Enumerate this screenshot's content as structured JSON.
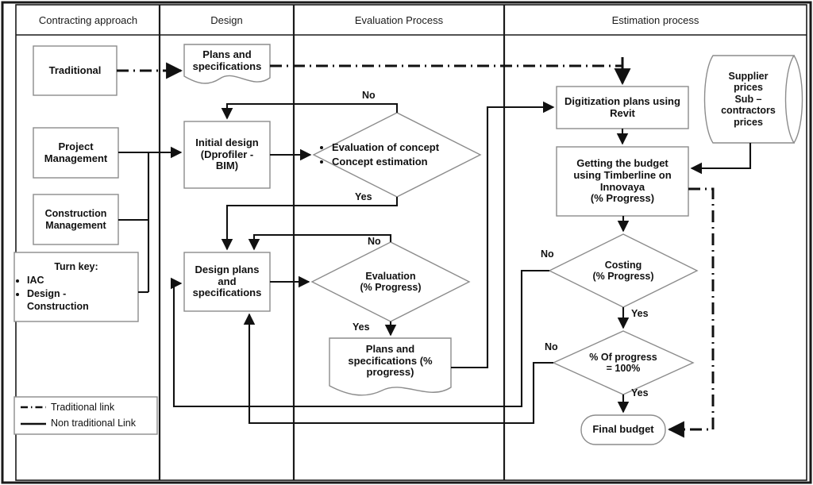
{
  "columns": [
    {
      "id": "contracting",
      "label": "Contracting approach"
    },
    {
      "id": "design",
      "label": "Design"
    },
    {
      "id": "evaluation",
      "label": "Evaluation Process"
    },
    {
      "id": "estimation",
      "label": "Estimation process"
    }
  ],
  "nodes": {
    "traditional": {
      "label": "Traditional",
      "shape": "rect"
    },
    "project_management": {
      "label": "Project\nManagement",
      "shape": "rect"
    },
    "construction_management": {
      "label": "Construction\nManagement",
      "shape": "rect"
    },
    "turnkey": {
      "shape": "rect",
      "heading": "Turn key:",
      "items": [
        "IAC",
        "Design -\nConstruction"
      ]
    },
    "plans_and_specifications": {
      "label": "Plans and\nspecifications",
      "shape": "document"
    },
    "initial_design": {
      "label": "Initial design\n(Dprofiler -\nBIM)",
      "shape": "rect"
    },
    "design_plans_and_specifications": {
      "label": "Design plans\nand\nspecifications",
      "shape": "rect"
    },
    "evaluation_concept": {
      "shape": "diamond",
      "items": [
        "Evaluation of concept",
        "Concept estimation"
      ]
    },
    "evaluation_progress": {
      "label": "Evaluation\n(% Progress)",
      "shape": "diamond"
    },
    "plans_specs_progress": {
      "label": "Plans and\nspecifications (%\nprogress)",
      "shape": "document"
    },
    "digitization": {
      "label": "Digitization plans using\nRevit",
      "shape": "rect"
    },
    "getting_budget": {
      "label": "Getting the budget\nusing Timberline on\nInnovaya\n(% Progress)",
      "shape": "rect"
    },
    "supplier_prices": {
      "label": "Supplier\nprices\nSub –\ncontractors\nprices",
      "shape": "cylinder"
    },
    "costing": {
      "label": "Costing\n(% Progress)",
      "shape": "diamond"
    },
    "percent_progress": {
      "label": "% Of progress\n= 100%",
      "shape": "diamond"
    },
    "final_budget": {
      "label": "Final budget",
      "shape": "stadium"
    }
  },
  "edge_labels": {
    "concept_no": "No",
    "concept_yes": "Yes",
    "evaluation_no": "No",
    "evaluation_yes": "Yes",
    "costing_no": "No",
    "costing_yes": "Yes",
    "percent_no": "No",
    "percent_yes": "Yes"
  },
  "legend": {
    "items": [
      {
        "style": "dash-dot",
        "label": "Traditional link"
      },
      {
        "style": "solid",
        "label": "Non traditional Link"
      }
    ]
  },
  "colors": {
    "stroke": "#111111",
    "node_border": "#8c8c8c",
    "background": "#ffffff",
    "frame": "#1a1a1a",
    "text": "#111111"
  },
  "chart_data": {
    "type": "diagram",
    "title": "",
    "swimlanes": [
      "Contracting approach",
      "Design",
      "Evaluation Process",
      "Estimation process"
    ],
    "flow": [
      {
        "from": "traditional",
        "to": "plans_and_specifications",
        "style": "dash-dot",
        "label": ""
      },
      {
        "from": "plans_and_specifications",
        "to": "digitization",
        "style": "dash-dot",
        "label": ""
      },
      {
        "from": "project_management",
        "to": "initial_design",
        "style": "solid",
        "label": ""
      },
      {
        "from": "construction_management",
        "to": "initial_design",
        "style": "solid",
        "label": ""
      },
      {
        "from": "turnkey",
        "to": "initial_design",
        "style": "solid",
        "label": ""
      },
      {
        "from": "initial_design",
        "to": "evaluation_concept",
        "style": "solid",
        "label": ""
      },
      {
        "from": "evaluation_concept",
        "to": "initial_design",
        "style": "solid",
        "label": "No"
      },
      {
        "from": "evaluation_concept",
        "to": "design_plans_and_specifications",
        "style": "solid",
        "label": "Yes"
      },
      {
        "from": "design_plans_and_specifications",
        "to": "evaluation_progress",
        "style": "solid",
        "label": ""
      },
      {
        "from": "evaluation_progress",
        "to": "design_plans_and_specifications",
        "style": "solid",
        "label": "No"
      },
      {
        "from": "evaluation_progress",
        "to": "plans_specs_progress",
        "style": "solid",
        "label": "Yes"
      },
      {
        "from": "plans_specs_progress",
        "to": "digitization",
        "style": "solid",
        "label": ""
      },
      {
        "from": "digitization",
        "to": "getting_budget",
        "style": "solid",
        "label": ""
      },
      {
        "from": "supplier_prices",
        "to": "getting_budget",
        "style": "solid",
        "label": ""
      },
      {
        "from": "getting_budget",
        "to": "costing",
        "style": "solid",
        "label": ""
      },
      {
        "from": "costing",
        "to": "design_plans_and_specifications",
        "style": "solid",
        "label": "No"
      },
      {
        "from": "costing",
        "to": "percent_progress",
        "style": "solid",
        "label": "Yes"
      },
      {
        "from": "percent_progress",
        "to": "design_plans_and_specifications",
        "style": "solid",
        "label": "No"
      },
      {
        "from": "percent_progress",
        "to": "final_budget",
        "style": "solid",
        "label": "Yes"
      },
      {
        "from": "getting_budget",
        "to": "final_budget",
        "style": "dash-dot",
        "label": ""
      }
    ]
  }
}
